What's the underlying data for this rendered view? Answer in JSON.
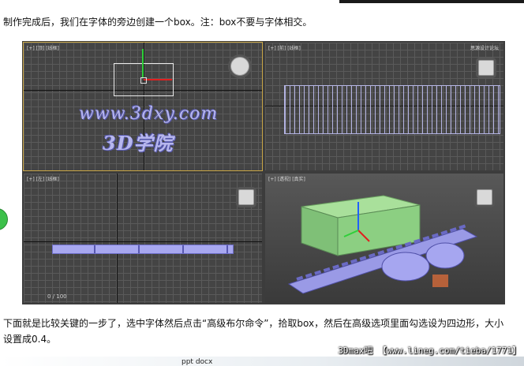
{
  "instructions": {
    "paragraph1": "制作完成后，我们在字体的旁边创建一个box。注：box不要与字体相交。",
    "paragraph2": "下面就是比较关键的一步了，选中字体然后点击“高级布尔命令”，拾取box，然后在高级选项里面勾选设为四边形，大小设置成0.4。"
  },
  "viewports": {
    "top_left_label": "[+] [顶] [线框]",
    "top_right_label": "[+] [前] [线框]",
    "top_right_corner": "思源设计论坛",
    "bottom_left_label": "[+] [左] [线框]",
    "bottom_right_label": "[+] [透视] [真实]",
    "watermark_url": "www.3dxy.com",
    "watermark_name": "3D学院",
    "status_readout": "0 / 100"
  },
  "footer": {
    "watermark": "3Dmax吧 【www.lineg.com/tieba/1771】",
    "bottom_text": "ppt docx"
  },
  "colors": {
    "viewport_bg": "#3c3c3c",
    "grid_line": "#5a5a5a",
    "active_border": "#c9a646",
    "box_green": "#8ccf82",
    "text_purple": "#b7b7ee"
  }
}
